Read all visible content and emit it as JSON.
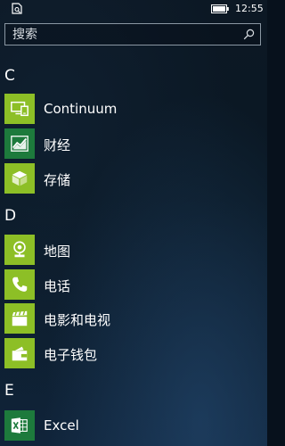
{
  "statusbar": {
    "time": "12:55",
    "left_icon": "notification-status-icon",
    "battery_icon": "battery-icon"
  },
  "search": {
    "placeholder": "搜索",
    "value": ""
  },
  "colors": {
    "tile_green": "#8dbf26",
    "tile_dark_green": "#1d7a3c",
    "background_top": "#0c1824",
    "background_bottom": "#10243a"
  },
  "groups": [
    {
      "letter": "C",
      "apps": [
        {
          "label": "Continuum",
          "icon": "continuum-icon",
          "tile_color": "#8dbf26"
        },
        {
          "label": "财经",
          "icon": "finance-icon",
          "tile_color": "#1d7a3c"
        },
        {
          "label": "存储",
          "icon": "storage-icon",
          "tile_color": "#8dbf26"
        }
      ]
    },
    {
      "letter": "D",
      "apps": [
        {
          "label": "地图",
          "icon": "maps-icon",
          "tile_color": "#8dbf26"
        },
        {
          "label": "电话",
          "icon": "phone-icon",
          "tile_color": "#8dbf26"
        },
        {
          "label": "电影和电视",
          "icon": "movies-tv-icon",
          "tile_color": "#8dbf26"
        },
        {
          "label": "电子钱包",
          "icon": "wallet-icon",
          "tile_color": "#8dbf26"
        }
      ]
    },
    {
      "letter": "E",
      "apps": [
        {
          "label": "Excel",
          "icon": "excel-icon",
          "tile_color": "#1d7a3c"
        }
      ]
    }
  ]
}
